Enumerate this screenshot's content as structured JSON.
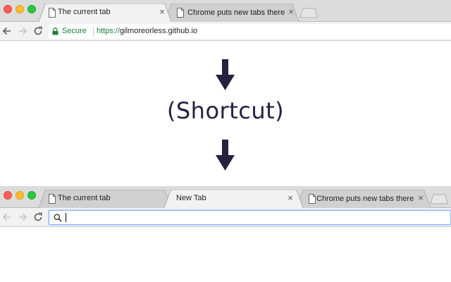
{
  "top_browser": {
    "tabs": [
      {
        "title": "The current tab",
        "active": true
      },
      {
        "title": "Chrome puts new tabs there ⇒",
        "active": false
      }
    ],
    "close_glyph": "×",
    "toolbar": {
      "secure_label": "Secure",
      "url": "https://",
      "url_host": "gilmoreorless.github.io"
    }
  },
  "annotation": {
    "label": "(Shortcut)"
  },
  "bottom_browser": {
    "tabs": [
      {
        "title": "The current tab",
        "active": false
      },
      {
        "title": "New Tab",
        "active": true
      },
      {
        "title": "Chrome puts new tabs there ⇒",
        "active": false
      }
    ],
    "close_glyph": "×",
    "toolbar": {
      "omnibox_value": ""
    }
  },
  "colors": {
    "secure_green": "#188038",
    "arrow": "#23233f",
    "tabstrip": "#dcdcdc",
    "toolbar": "#f2f2f2",
    "focus_ring": "#8ab4f8"
  },
  "icons": [
    "page-icon",
    "back-icon",
    "forward-icon",
    "reload-icon",
    "lock-icon",
    "search-icon",
    "down-arrow-icon",
    "close-icon",
    "new-tab-icon"
  ]
}
